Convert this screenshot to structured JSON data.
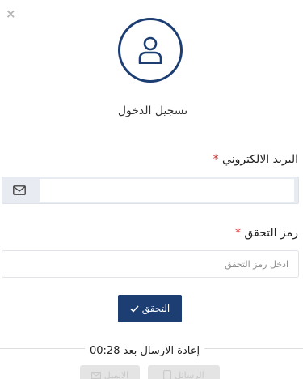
{
  "close": {
    "glyph": "×"
  },
  "title": "تسجيل الدخول",
  "email": {
    "label": "البريد الالكتروني",
    "required_mark": "*",
    "value": ""
  },
  "code": {
    "label": "رمز التحقق",
    "required_mark": "*",
    "placeholder": "ادخل رمز التحقق",
    "value": ""
  },
  "verify_button": {
    "label": "التحقق",
    "icon": "check-icon"
  },
  "resend": {
    "text": "إعادة الارسال بعد 00:28"
  },
  "bottom_buttons": [
    {
      "label": "الايميل",
      "icon": "email-icon"
    },
    {
      "label": "الرسائل",
      "icon": "sms-icon"
    }
  ],
  "colors": {
    "primary": "#1c3e73",
    "required": "#d32f2f"
  }
}
